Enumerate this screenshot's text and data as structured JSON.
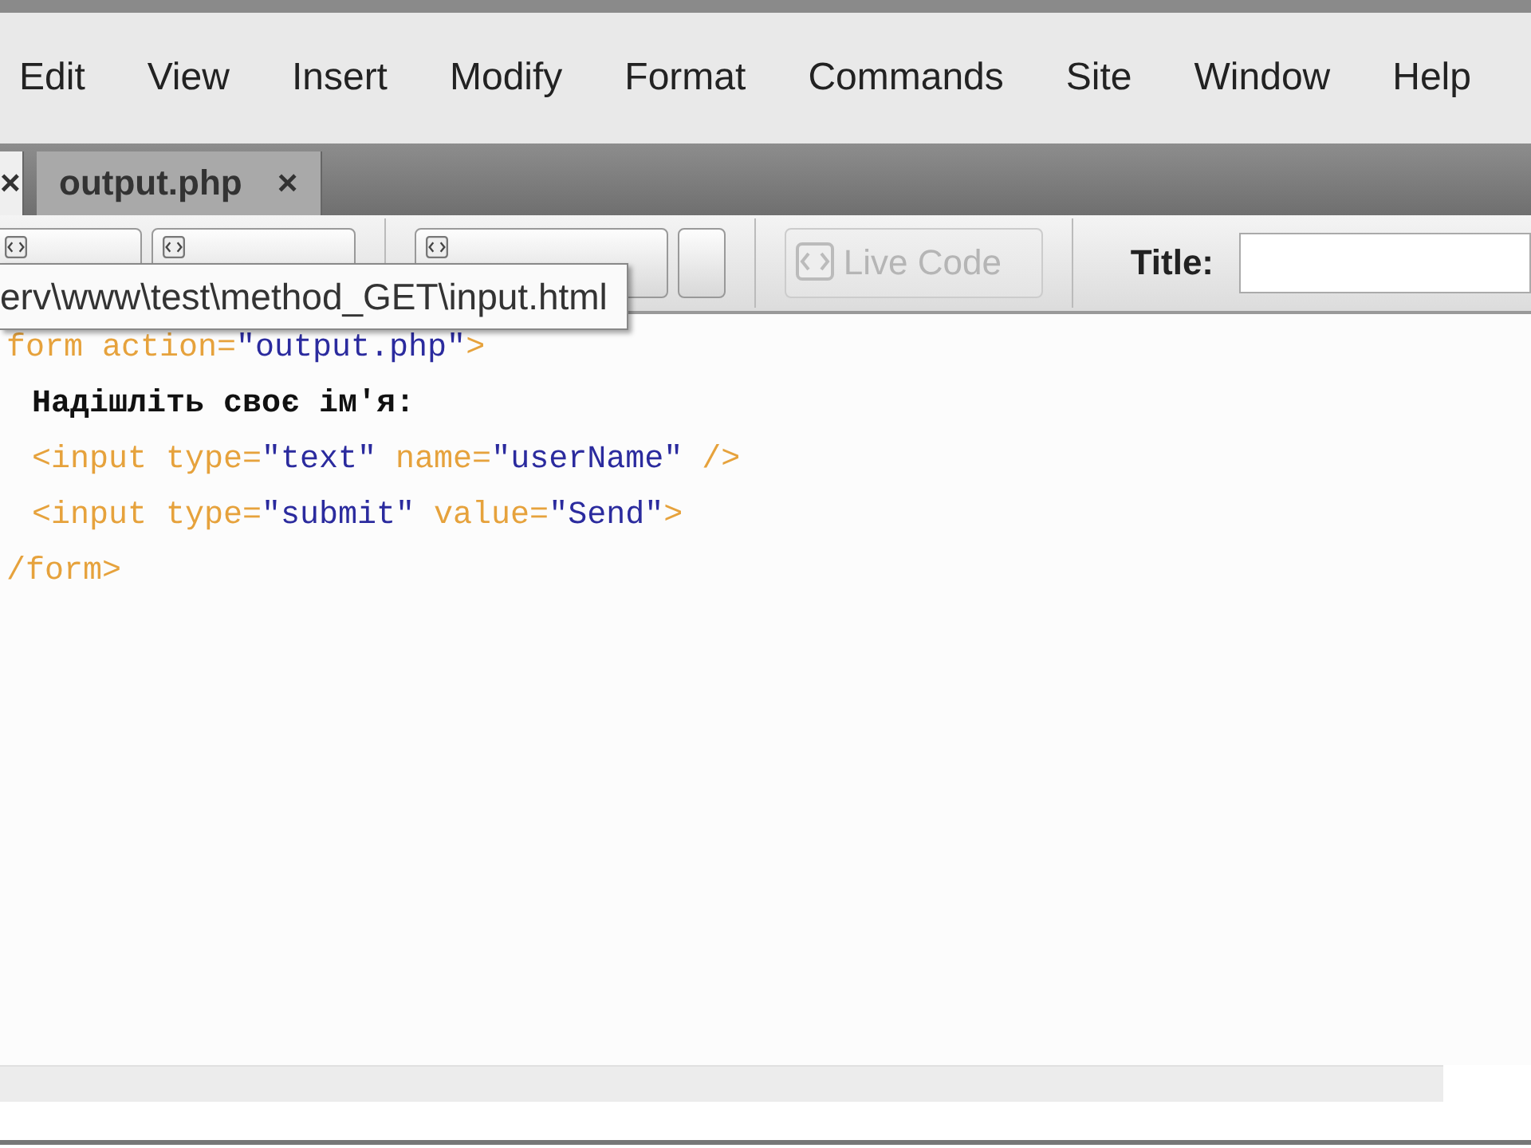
{
  "menu_bar": {
    "items": [
      "Edit",
      "View",
      "Insert",
      "Modify",
      "Format",
      "Commands",
      "Site",
      "Window",
      "Help"
    ]
  },
  "document_tabs": [
    {
      "close": "×",
      "selected": true
    },
    {
      "label": "output.php",
      "close": "×",
      "selected": false
    }
  ],
  "toolbar": {
    "buttons": [
      {
        "kind": "code",
        "disabled": false
      },
      {
        "kind": "design",
        "disabled": false
      },
      {
        "kind": "live-view",
        "disabled": false
      },
      {
        "kind": "small",
        "disabled": false
      },
      {
        "kind": "live-code",
        "label": "Live Code",
        "disabled": true
      }
    ],
    "title_label": "Title:"
  },
  "tooltip": "erv\\www\\test\\method_GET\\input.html",
  "code_lines": [
    {
      "indent": false,
      "tokens": [
        {
          "kind": "tag",
          "text": "form "
        },
        {
          "kind": "attr",
          "text": "action="
        },
        {
          "kind": "value",
          "text": "\"output.php\""
        },
        {
          "kind": "tag",
          "text": ">"
        }
      ]
    },
    {
      "indent": true,
      "tokens": [
        {
          "kind": "text",
          "text": "Надішліть своє ім'я:"
        }
      ]
    },
    {
      "indent": true,
      "tokens": [
        {
          "kind": "tag",
          "text": "<input "
        },
        {
          "kind": "attr",
          "text": "type="
        },
        {
          "kind": "value",
          "text": "\"text\""
        },
        {
          "kind": "attr",
          "text": " name="
        },
        {
          "kind": "value",
          "text": "\"userName\""
        },
        {
          "kind": "tag",
          "text": " />"
        }
      ]
    },
    {
      "indent": true,
      "tokens": [
        {
          "kind": "tag",
          "text": "<input "
        },
        {
          "kind": "attr",
          "text": "type="
        },
        {
          "kind": "value",
          "text": "\"submit\""
        },
        {
          "kind": "attr",
          "text": " value="
        },
        {
          "kind": "value",
          "text": "\"Send\""
        },
        {
          "kind": "tag",
          "text": ">"
        }
      ]
    },
    {
      "indent": false,
      "tokens": [
        {
          "kind": "tag",
          "text": "/form>"
        }
      ]
    }
  ]
}
